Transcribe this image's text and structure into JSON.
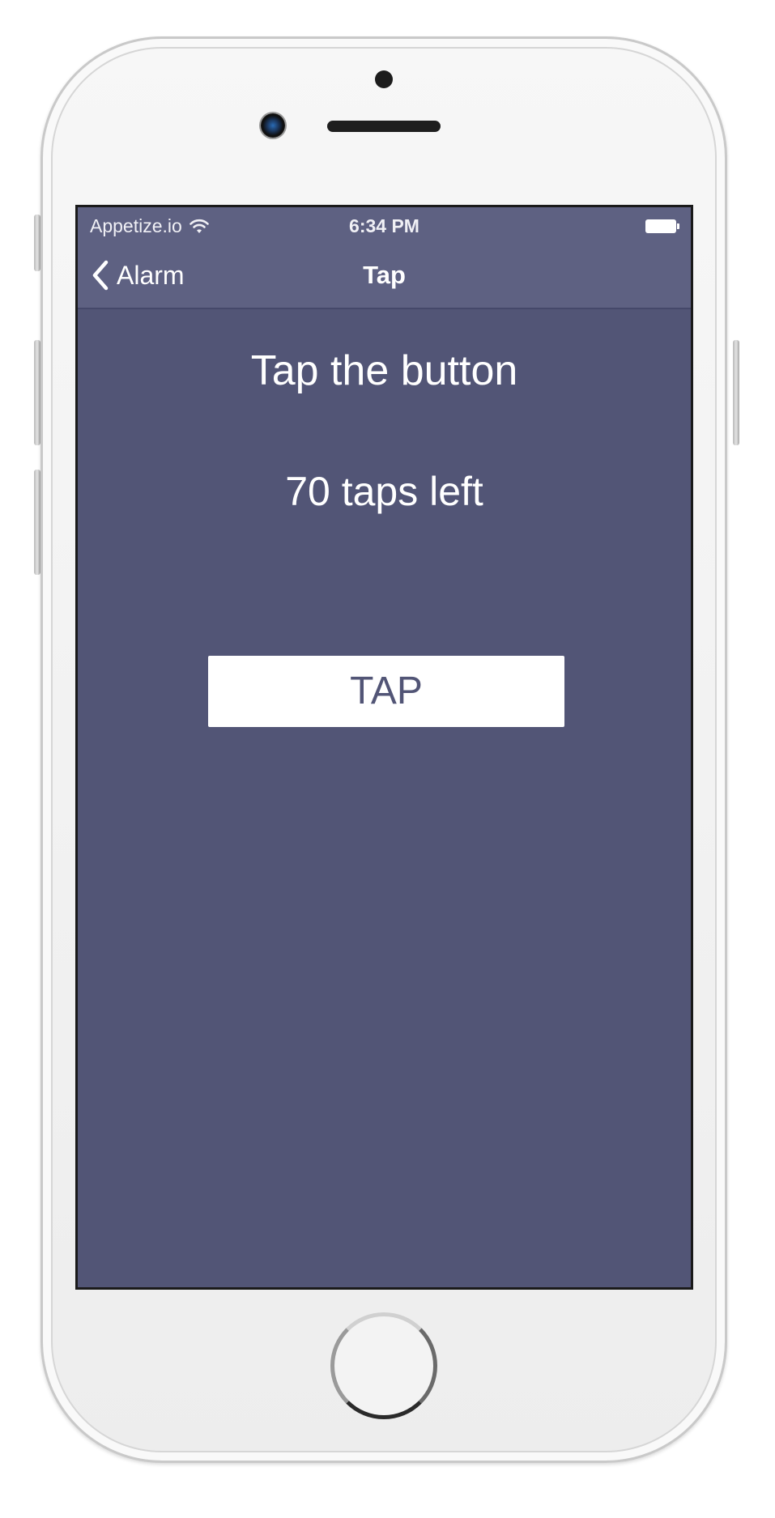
{
  "status_bar": {
    "carrier": "Appetize.io",
    "time": "6:34 PM",
    "wifi_icon": "wifi-icon",
    "battery_icon": "battery-full-icon"
  },
  "nav": {
    "back_label": "Alarm",
    "back_icon": "chevron-left-icon",
    "title": "Tap"
  },
  "main": {
    "heading": "Tap the button",
    "counter": "70 taps left",
    "button_label": "TAP"
  },
  "colors": {
    "background": "#525576",
    "bar": "#5e6182",
    "button_bg": "#ffffff",
    "button_text": "#525576"
  }
}
